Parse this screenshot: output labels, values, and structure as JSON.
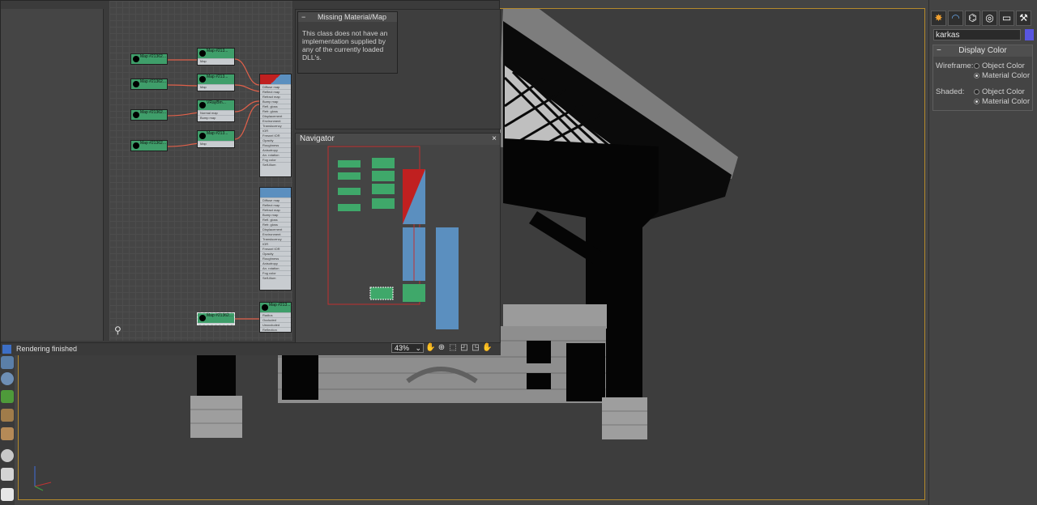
{
  "slate": {
    "missing_rollout_title": "Missing Material/Map",
    "missing_text_lines": [
      "This class does not have an",
      "implementation supplied by",
      "any of the currently loaded",
      "DLL's."
    ],
    "navigator_title": "Navigator",
    "navigator_close": "×",
    "status_text": "Rendering finished",
    "zoom_value": "43%",
    "nodes": [
      {
        "title": "Map #21362...",
        "subtitle": "Missing Text..."
      },
      {
        "title": "Map #21362...",
        "subtitle": "Missing Text..."
      },
      {
        "title": "Map #21362...",
        "subtitle": "Missing Text..."
      },
      {
        "title": "Map #21362...",
        "subtitle": "Missing Text..."
      },
      {
        "title": "Map #213...",
        "subtitle": "Color Cor..."
      },
      {
        "title": "Map #213...",
        "subtitle": "Output"
      },
      {
        "title": "VRayBm...",
        "subtitle": "VRayNor..."
      },
      {
        "title": "Map #213...",
        "subtitle": "Output"
      },
      {
        "title": "Map #21362...",
        "subtitle": "Missing Text..."
      },
      {
        "title": "Map #213...",
        "subtitle": "VRayDirt"
      }
    ],
    "material_slots": [
      "Diffuse map",
      "Reflect map",
      "Refract map",
      "Bump map",
      "Refl. gloss",
      "Refr. gloss",
      "Displacement",
      "Environment",
      "Translucency",
      "IOR",
      "Fresnel IOR",
      "Opacity",
      "Roughness",
      "Anisotropy",
      "An. rotation",
      "Fog color",
      "Self-illum"
    ],
    "vraydirt_slots": [
      "Radius",
      "Occluded",
      "Unoccluded",
      "Reflection"
    ]
  },
  "command_panel": {
    "tabs": [
      "create-icon",
      "modify-icon",
      "hierarchy-icon",
      "motion-icon",
      "display-icon",
      "utilities-icon"
    ],
    "object_name": "karkas",
    "object_color": "#5856e0",
    "rollout_title": "Display Color",
    "rollout_toggle": "−",
    "wireframe_label": "Wireframe:",
    "shaded_label": "Shaded:",
    "option_object_color": "Object Color",
    "option_material_color": "Material Color",
    "wireframe_selected": "Material Color",
    "shaded_selected": "Material Color"
  },
  "viewport": {
    "border_color": "#b48a2c",
    "axis_labels": [
      "x",
      "y",
      "z"
    ]
  }
}
